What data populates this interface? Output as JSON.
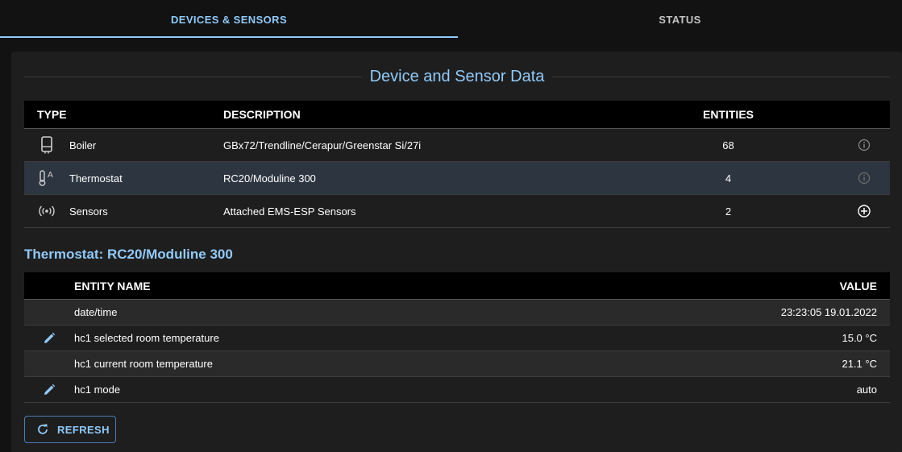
{
  "tabs": [
    {
      "label": "DEVICES & SENSORS",
      "active": true
    },
    {
      "label": "STATUS",
      "active": false
    }
  ],
  "section_title": "Device and Sensor Data",
  "devices_table": {
    "headers": {
      "type": "TYPE",
      "description": "DESCRIPTION",
      "entities": "ENTITIES"
    },
    "rows": [
      {
        "icon": "boiler-icon",
        "type": "Boiler",
        "description": "GBx72/Trendline/Cerapur/Greenstar Si/27i",
        "entities": "68",
        "action_icon": "info-icon",
        "selected": false
      },
      {
        "icon": "thermostat-icon",
        "type": "Thermostat",
        "description": "RC20/Moduline 300",
        "entities": "4",
        "action_icon": "info-icon",
        "selected": true
      },
      {
        "icon": "sensors-icon",
        "type": "Sensors",
        "description": "Attached EMS-ESP Sensors",
        "entities": "2",
        "action_icon": "add-circle-icon",
        "selected": false
      }
    ]
  },
  "detail_title": "Thermostat: RC20/Moduline 300",
  "entities_table": {
    "headers": {
      "name": "ENTITY NAME",
      "value": "VALUE"
    },
    "rows": [
      {
        "editable": false,
        "name": "date/time",
        "value": "23:23:05 19.01.2022"
      },
      {
        "editable": true,
        "name": "hc1 selected room temperature",
        "value": "15.0 °C"
      },
      {
        "editable": false,
        "name": "hc1 current room temperature",
        "value": "21.1 °C"
      },
      {
        "editable": true,
        "name": "hc1 mode",
        "value": "auto"
      }
    ]
  },
  "refresh_button": {
    "label": "REFRESH",
    "icon": "refresh-icon"
  },
  "colors": {
    "accent": "#90caf9",
    "background": "#121212",
    "panel": "#1e1e1e",
    "selected_row": "#2d3540"
  }
}
